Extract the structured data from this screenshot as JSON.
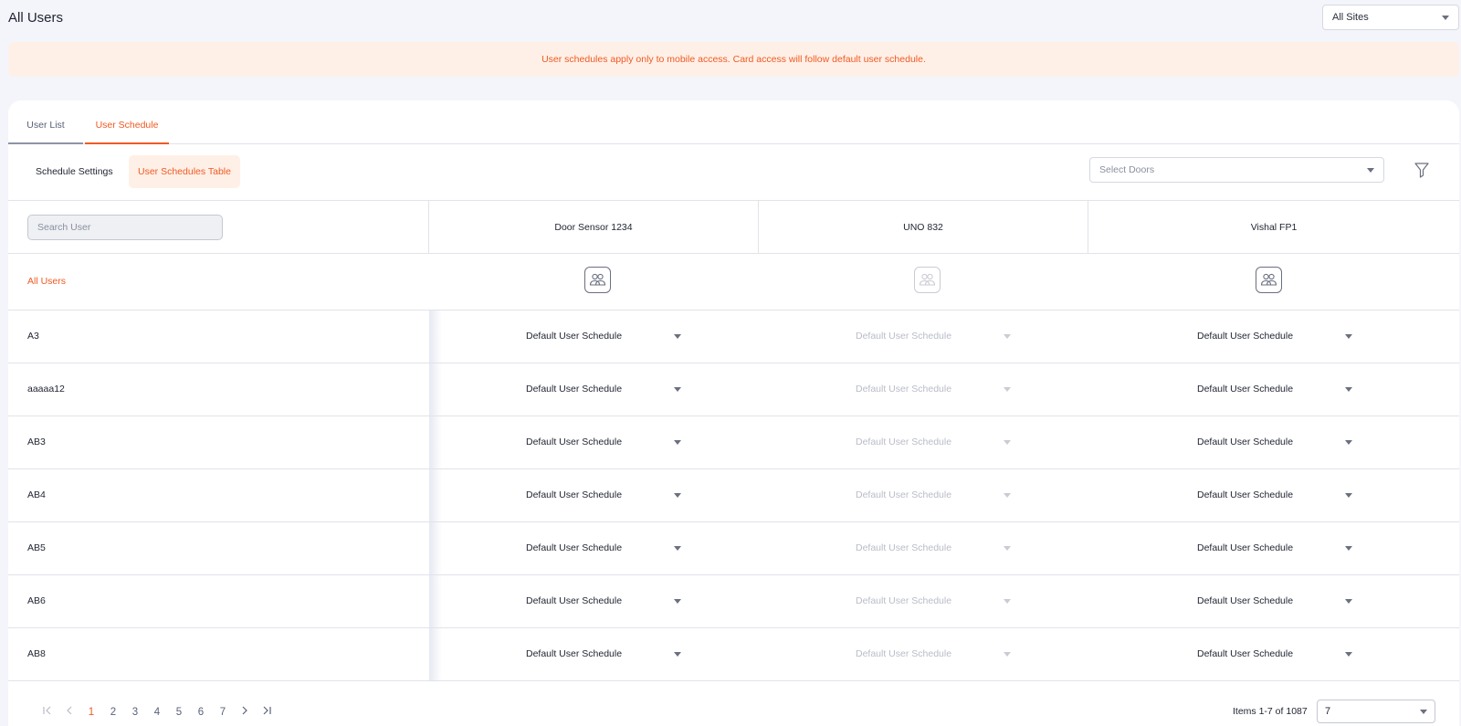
{
  "header": {
    "title": "All Users",
    "site_select": "All Sites"
  },
  "banner": {
    "text": "User schedules apply only to mobile access. Card access will follow default user schedule."
  },
  "tabs": [
    {
      "label": "User List"
    },
    {
      "label": "User Schedule"
    }
  ],
  "subtabs": {
    "settings": "Schedule Settings",
    "table": "User Schedules Table"
  },
  "door_select": {
    "placeholder": "Select Doors"
  },
  "search": {
    "placeholder": "Search User"
  },
  "doors": [
    "Door Sensor 1234",
    "UNO 832",
    "Vishal FP1"
  ],
  "all_users_label": "All Users",
  "rows": [
    {
      "name": "A3",
      "schedules": [
        "Default User Schedule",
        "Default User Schedule",
        "Default User Schedule"
      ]
    },
    {
      "name": "aaaaa12",
      "schedules": [
        "Default User Schedule",
        "Default User Schedule",
        "Default User Schedule"
      ]
    },
    {
      "name": "AB3",
      "schedules": [
        "Default User Schedule",
        "Default User Schedule",
        "Default User Schedule"
      ]
    },
    {
      "name": "AB4",
      "schedules": [
        "Default User Schedule",
        "Default User Schedule",
        "Default User Schedule"
      ]
    },
    {
      "name": "AB5",
      "schedules": [
        "Default User Schedule",
        "Default User Schedule",
        "Default User Schedule"
      ]
    },
    {
      "name": "AB6",
      "schedules": [
        "Default User Schedule",
        "Default User Schedule",
        "Default User Schedule"
      ]
    },
    {
      "name": "AB8",
      "schedules": [
        "Default User Schedule",
        "Default User Schedule",
        "Default User Schedule"
      ]
    }
  ],
  "pagination": {
    "pages": [
      "1",
      "2",
      "3",
      "4",
      "5",
      "6",
      "7"
    ],
    "current": "1",
    "items_info": "Items 1-7 of 1087",
    "per_page": "7"
  },
  "colors": {
    "accent": "#ef5a23",
    "banner_bg": "#fff0e7",
    "disabled_text": "#b8bcc7"
  },
  "icons": {
    "group": "group-icon",
    "filter": "filter-icon",
    "first": "first-page-icon",
    "prev": "prev-page-icon",
    "next": "next-page-icon",
    "last": "last-page-icon"
  }
}
